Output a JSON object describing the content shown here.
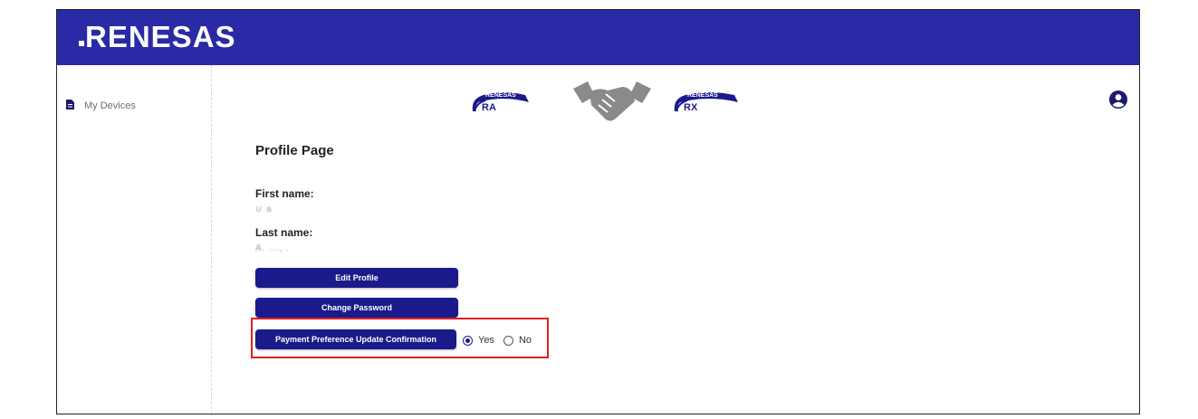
{
  "brand": {
    "name": "RENESAS",
    "header_color": "#2a2aa6",
    "button_color": "#1b1a8a"
  },
  "sidebar": {
    "items": [
      {
        "label": "My Devices",
        "icon": "document-icon"
      }
    ]
  },
  "logos": {
    "ra": {
      "brand": "RENESAS",
      "label": "RA"
    },
    "handshake": {
      "icon": "handshake-icon"
    },
    "rx": {
      "brand": "RENESAS",
      "label": "RX"
    }
  },
  "profile": {
    "title": "Profile Page",
    "first_name_label": "First name:",
    "first_name_value": "∪ a",
    "last_name_label": "Last name:",
    "last_name_value": "A. ..., .",
    "buttons": {
      "edit_profile": "Edit Profile",
      "change_password": "Change Password",
      "payment_preference": "Payment Preference Update Confirmation"
    },
    "payment_options": [
      {
        "label": "Yes",
        "selected": true
      },
      {
        "label": "No",
        "selected": false
      }
    ]
  },
  "highlight_color": "#e02020"
}
